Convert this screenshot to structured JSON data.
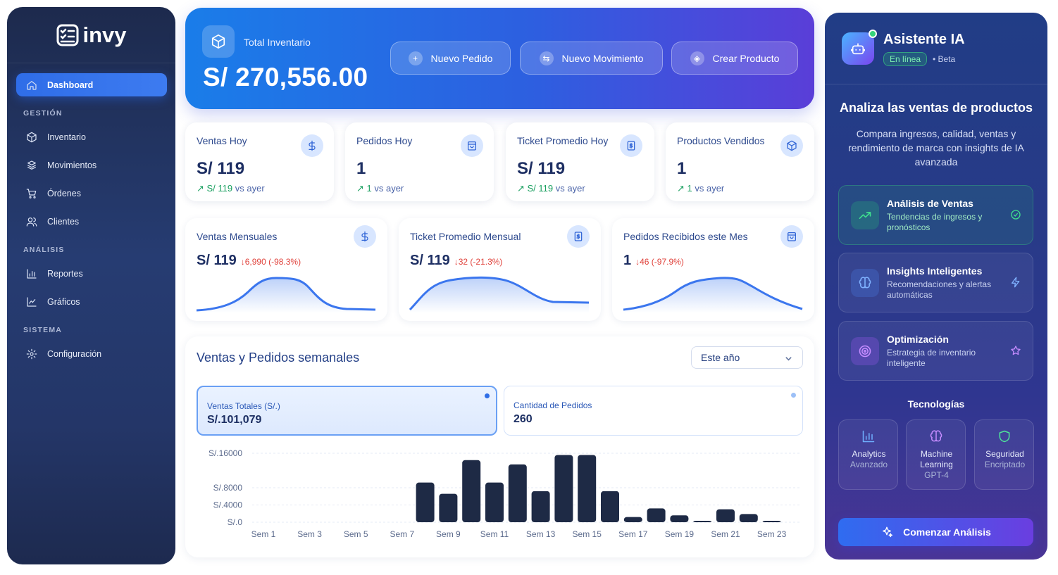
{
  "app": {
    "name": "invy"
  },
  "sidebar": {
    "dashboard": "Dashboard",
    "sections": {
      "gestion": "GESTIÓN",
      "analisis": "ANÁLISIS",
      "sistema": "SISTEMA"
    },
    "items": {
      "inventario": "Inventario",
      "movimientos": "Movimientos",
      "ordenes": "Órdenes",
      "clientes": "Clientes",
      "reportes": "Reportes",
      "graficos": "Gráficos",
      "configuracion": "Configuración"
    }
  },
  "hero": {
    "label": "Total Inventario",
    "value": "S/ 270,556.00",
    "buttons": {
      "nuevo_pedido": "Nuevo Pedido",
      "nuevo_movimiento": "Nuevo Movimiento",
      "crear_producto": "Crear Producto"
    }
  },
  "kpis": [
    {
      "title": "Ventas Hoy",
      "value": "S/ 119",
      "trend": "S/ 119",
      "trend_suffix": " vs ayer",
      "icon": "dollar-icon"
    },
    {
      "title": "Pedidos Hoy",
      "value": "1",
      "trend": "1",
      "trend_suffix": " vs ayer",
      "icon": "bag-icon"
    },
    {
      "title": "Ticket Promedio Hoy",
      "value": "S/ 119",
      "trend": "S/ 119",
      "trend_suffix": " vs ayer",
      "icon": "receipt-icon"
    },
    {
      "title": "Productos Vendidos",
      "value": "1",
      "trend": "1",
      "trend_suffix": " vs ayer",
      "icon": "box-icon"
    }
  ],
  "monthly": [
    {
      "title": "Ventas Mensuales",
      "value": "S/ 119",
      "delta": "6,990 (-98.3%)"
    },
    {
      "title": "Ticket Promedio Mensual",
      "value": "S/ 119",
      "delta": "32 (-21.3%)"
    },
    {
      "title": "Pedidos Recibidos este Mes",
      "value": "1",
      "delta": "46 (-97.9%)"
    }
  ],
  "weekly": {
    "title": "Ventas y Pedidos semanales",
    "period": "Este año",
    "stats": {
      "ventas_label": "Ventas Totales (S/.)",
      "ventas_value": "S/.101,079",
      "pedidos_label": "Cantidad de Pedidos",
      "pedidos_value": "260"
    }
  },
  "chart_data": {
    "type": "bar",
    "categories": [
      "Sem 1",
      "Sem 2",
      "Sem 3",
      "Sem 4",
      "Sem 5",
      "Sem 6",
      "Sem 7",
      "Sem 8",
      "Sem 9",
      "Sem 10",
      "Sem 11",
      "Sem 12",
      "Sem 13",
      "Sem 14",
      "Sem 15",
      "Sem 16",
      "Sem 17",
      "Sem 18",
      "Sem 19",
      "Sem 20",
      "Sem 21",
      "Sem 22",
      "Sem 23"
    ],
    "tick_labels": [
      "Sem 1",
      "Sem 3",
      "Sem 5",
      "Sem 7",
      "Sem 9",
      "Sem 11",
      "Sem 13",
      "Sem 15",
      "Sem 17",
      "Sem 19",
      "Sem 21",
      "Sem 23"
    ],
    "values": [
      0,
      0,
      0,
      0,
      0,
      0,
      0,
      9200,
      6600,
      14400,
      9200,
      13400,
      7200,
      15600,
      15600,
      7200,
      1200,
      3200,
      1600,
      200,
      3000,
      1900,
      200
    ],
    "yticks": [
      "S/.16000",
      "S/.8000",
      "S/.4000",
      "S/.0"
    ],
    "ytick_values": [
      16000,
      8000,
      4000,
      0
    ],
    "ylim": [
      0,
      16000
    ],
    "bar_color": "#1e2a45"
  },
  "assistant": {
    "title": "Asistente IA",
    "status": "En línea",
    "beta": "• Beta",
    "heading": "Analiza las ventas de productos",
    "description": "Compara ingresos, calidad, ventas y rendimiento de marca con insights de IA avanzada",
    "features": [
      {
        "title": "Análisis de Ventas",
        "desc": "Tendencias de ingresos y pronósticos"
      },
      {
        "title": "Insights Inteligentes",
        "desc": "Recomendaciones y alertas automáticas"
      },
      {
        "title": "Optimización",
        "desc": "Estrategia de inventario inteligente"
      }
    ],
    "tech_title": "Tecnologías",
    "tech": [
      {
        "name": "Analytics",
        "sub": "Avanzado"
      },
      {
        "name": "Machine Learning",
        "sub": "GPT-4"
      },
      {
        "name": "Seguridad",
        "sub": "Encriptado"
      }
    ],
    "cta": "Comenzar Análisis"
  }
}
